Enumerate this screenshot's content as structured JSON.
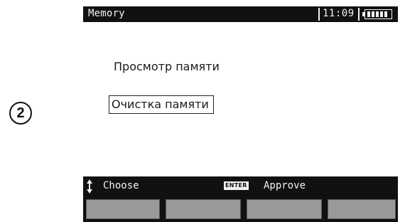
{
  "step_marker": "2",
  "window": {
    "title": "Memory",
    "time": "11:09",
    "battery_icon": "battery-full-icon"
  },
  "menu": {
    "items": [
      {
        "label": "Просмотр памяти",
        "selected": false
      },
      {
        "label": "Очистка памяти",
        "selected": true
      }
    ]
  },
  "status_bar": {
    "choose_icon": "up-down-arrows-icon",
    "choose_label": "Choose",
    "enter_key": "ENTER",
    "approve_label": "Approve"
  },
  "softkeys": {
    "count": 4
  },
  "colors": {
    "bar_background": "#111111",
    "bar_text": "#f2f2f2",
    "softkey_fill": "#9a9a9a",
    "screen_background": "#ffffff"
  }
}
